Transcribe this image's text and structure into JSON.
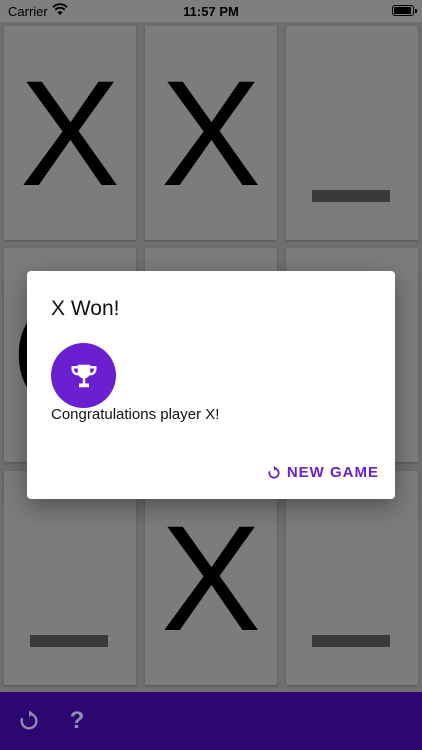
{
  "status_bar": {
    "carrier": "Carrier",
    "time": "11:57 PM",
    "wifi_icon": "wifi-icon",
    "battery_icon": "battery-icon"
  },
  "board": {
    "cells": [
      {
        "mark": "X"
      },
      {
        "mark": "X"
      },
      {
        "mark": ""
      },
      {
        "mark": "O"
      },
      {
        "mark": ""
      },
      {
        "mark": ""
      },
      {
        "mark": ""
      },
      {
        "mark": "X"
      },
      {
        "mark": ""
      }
    ]
  },
  "dialog": {
    "title": "X Won!",
    "icon": "trophy-icon",
    "message": "Congratulations player X!",
    "action_label": "NEW GAME",
    "action_icon": "refresh-icon",
    "accent_color": "#6a1fd0"
  },
  "toolbar": {
    "background": "#2c0673",
    "refresh_icon": "refresh-icon",
    "help_label": "?"
  }
}
